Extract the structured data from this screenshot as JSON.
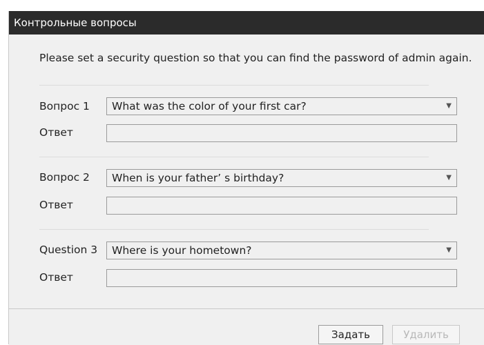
{
  "dialog": {
    "title": "Контрольные вопросы",
    "intro": "Please set a security question so that you can find the password of admin again."
  },
  "questions": [
    {
      "label": "Вопрос 1",
      "selected": "What was the color of your first car?",
      "answer_label": "Ответ",
      "answer_value": ""
    },
    {
      "label": "Вопрос 2",
      "selected": "When is your father’ s birthday?",
      "answer_label": "Ответ",
      "answer_value": ""
    },
    {
      "label": "Question 3",
      "selected": "Where is your hometown?",
      "answer_label": "Ответ",
      "answer_value": ""
    }
  ],
  "icons": {
    "dropdown": "▼"
  },
  "buttons": {
    "set_label": "Задать",
    "delete_label": "Удалить"
  },
  "colors": {
    "titlebar": "#2b2b2b",
    "panel": "#f0f0f0",
    "disabled_text": "#b8b8b8"
  }
}
